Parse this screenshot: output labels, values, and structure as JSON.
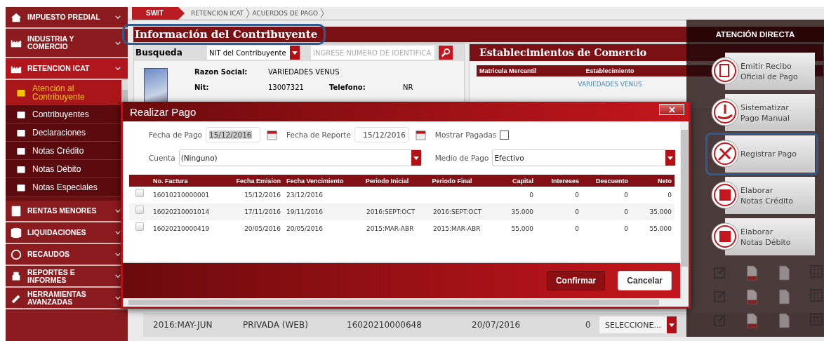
{
  "sidebar": {
    "items": [
      {
        "label": "IMPUESTO PREDIAL",
        "selected": false
      },
      {
        "label": "INDUSTRIA Y\nCOMERCIO",
        "selected": false
      },
      {
        "label": "RETENCION ICAT",
        "selected": true,
        "children": [
          {
            "label": "Atención al\nContribuyente",
            "selected": true
          },
          {
            "label": "Contribuyentes",
            "selected": false
          },
          {
            "label": "Declaraciones",
            "selected": false
          },
          {
            "label": "Notas Crédito",
            "selected": false
          },
          {
            "label": "Notas Débito",
            "selected": false
          },
          {
            "label": "Notas Especiales",
            "selected": false
          }
        ]
      },
      {
        "label": "RENTAS MENORES",
        "selected": false
      },
      {
        "label": "LIQUIDACIONES",
        "selected": false
      },
      {
        "label": "RECAUDOS",
        "selected": false
      },
      {
        "label": "REPORTES E INFORMES",
        "selected": false
      },
      {
        "label": "HERRAMIENTAS\nAVANZADAS",
        "selected": false
      }
    ]
  },
  "breadcrumb": [
    "SWIT",
    "RETENCION ICAT",
    "ACUERDOS DE PAGO"
  ],
  "contribuyente": {
    "title": "Información del Contribuyente",
    "highlighted": true,
    "search": {
      "label": "Busqueda",
      "type": "NIT del Contribuyente",
      "placeholder": "INGRESE NUMERO DE IDENTIFICA"
    },
    "fields": [
      [
        {
          "label": "Razon Social:",
          "value": "VARIEDADES VENUS"
        }
      ],
      [
        {
          "label": "Nit:",
          "value": "13007321"
        },
        {
          "label": "Telefono:",
          "value": "NR"
        }
      ]
    ]
  },
  "establecimientos": {
    "title": "Establecimientos de Comercio",
    "columns": [
      "Matricula Mercantil",
      "Establecimiento"
    ],
    "rows": [
      {
        "establecimiento": "VARIEDADES VENUS"
      }
    ]
  },
  "background_row": {
    "cells": [
      "2016:MAY-JUN",
      "PRIVADA (WEB)",
      "16020210000648",
      "20/07/2016",
      "0"
    ],
    "select": "SELECCIONE..."
  },
  "atencion_directa": {
    "title": "ATENCIÓN DIRECTA",
    "actions": [
      {
        "label": "Emitir Recibo\nOficial de Pago",
        "highlighted": false
      },
      {
        "label": "Sistematizar\nPago Manual",
        "highlighted": false
      },
      {
        "label": "Registrar Pago",
        "highlighted": true
      },
      {
        "label": "Elaborar\nNotas Crédito",
        "highlighted": false
      },
      {
        "label": "Elaborar\nNotas Débito",
        "highlighted": false
      }
    ]
  },
  "modal": {
    "title": "Realizar Pago",
    "fecha_pago": {
      "label": "Fecha de Pago",
      "value": "15/12/2016",
      "selected": true
    },
    "fecha_reporte": {
      "label": "Fecha de Reporte",
      "value": "15/12/2016",
      "selected": false
    },
    "mostrar_pagadas": {
      "label": "Mostrar Pagadas",
      "checked": false
    },
    "cuenta": {
      "label": "Cuenta",
      "value": "(Ninguno)"
    },
    "medio_pago": {
      "label": "Medio de Pago",
      "value": "Efectivo"
    },
    "table": {
      "columns": [
        "No. Factura",
        "Fecha Emision",
        "Fecha Vencimiento",
        "Periodo Inicial",
        "Periodo Final",
        "Capital",
        "Intereses",
        "Descuento",
        "Neto"
      ],
      "rows": [
        {
          "checked": false,
          "cells": [
            "16010210000001",
            "15/12/2016",
            "23/12/2016",
            null,
            null,
            "0",
            "0",
            "0",
            "0"
          ]
        },
        {
          "checked": false,
          "cells": [
            "16020210001014",
            "17/11/2016",
            "19/11/2016",
            "2016:SEPT:OCT",
            "2016:SEPT:OCT",
            "35.000",
            "0",
            "0",
            "35.000"
          ]
        },
        {
          "checked": false,
          "cells": [
            "16020210000419",
            "20/05/2016",
            "20/05/2016",
            "2015:MAR-ABR",
            "2015:MAR-ABR",
            "55.000",
            "0",
            "0",
            "55.000"
          ]
        }
      ]
    },
    "buttons": [
      {
        "label": "Confirmar",
        "kind": "primary"
      },
      {
        "label": "Cancelar",
        "kind": "secondary"
      }
    ]
  }
}
